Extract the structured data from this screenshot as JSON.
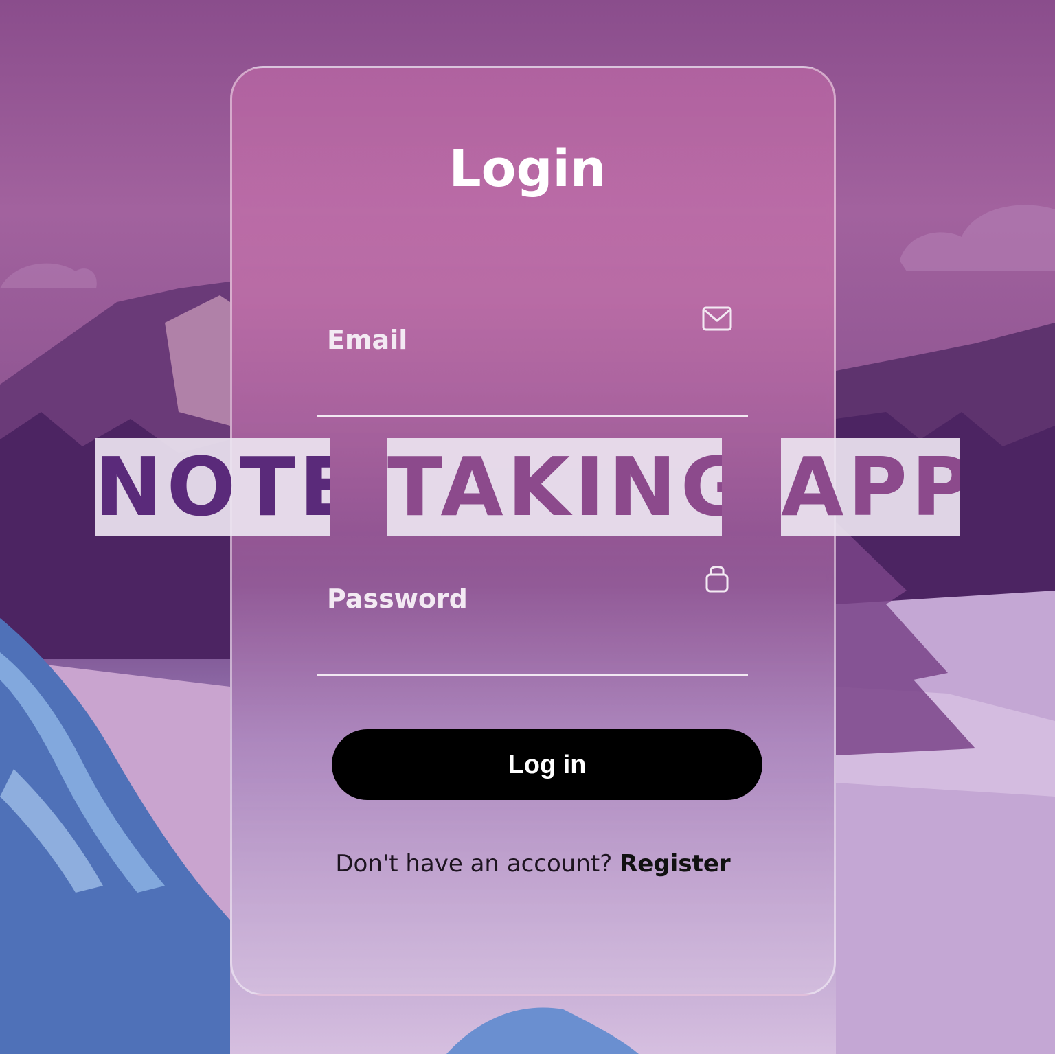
{
  "login": {
    "title": "Login",
    "email_label": "Email",
    "email_icon": "envelope-icon",
    "password_label": "Password",
    "password_icon": "lock-icon",
    "submit_label": "Log in",
    "register_prompt": "Don't have an account?",
    "register_link": "Register"
  },
  "banner": {
    "word1": "NOTE",
    "word2": "TAKING",
    "word3": "APP"
  },
  "colors": {
    "accent": "#7a3f86",
    "button": "#000000",
    "card_border": "#ffffff"
  }
}
